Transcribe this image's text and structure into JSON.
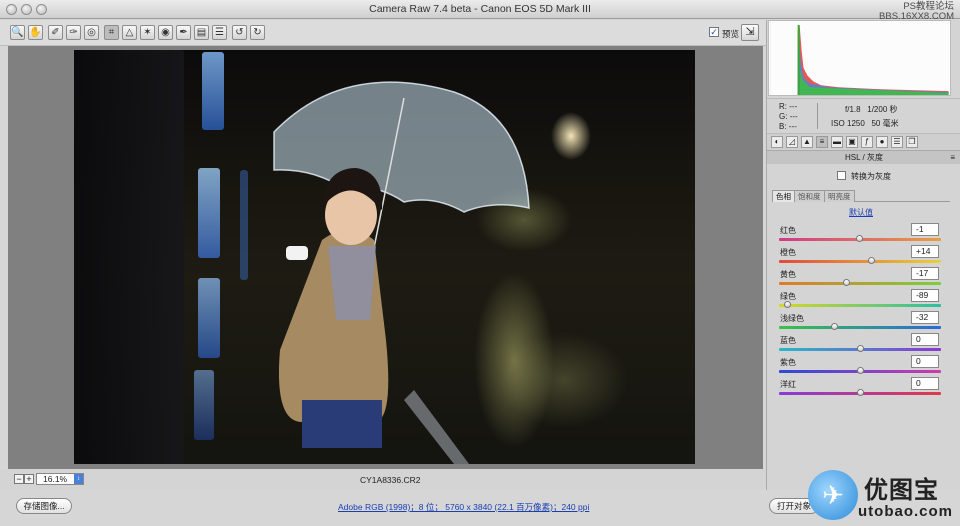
{
  "window": {
    "title": "Camera Raw 7.4 beta -  Canon EOS 5D Mark III"
  },
  "watermark_top": {
    "line1": "PS教程论坛",
    "line2": "BBS.16XX8.COM"
  },
  "toolbar": {
    "tools": [
      "zoom-tool",
      "hand-tool",
      "white-balance-tool",
      "color-sampler-tool",
      "targeted-adjustment-tool",
      "crop-tool",
      "straighten-tool",
      "spot-removal-tool",
      "red-eye-tool",
      "adjustment-brush-tool",
      "graduated-filter-tool",
      "radial-filter-tool",
      "preferences",
      "rotate-left",
      "rotate-right"
    ],
    "preview_label": "预览",
    "preview_checked": true
  },
  "status": {
    "zoom": "16.1%",
    "filename": "CY1A8336.CR2"
  },
  "bottom": {
    "save_label": "存储图像...",
    "workflow_text": "Adobe RGB (1998)；8 位；  5760 x 3840 (22.1 百万像素)；240 ppi",
    "open_label": "打开对象"
  },
  "watermark_bottom": {
    "brand": "优图宝",
    "url": "utobao.com"
  },
  "readout": {
    "r_label": "R:",
    "r_val": "---",
    "g_label": "G:",
    "g_val": "---",
    "b_label": "B:",
    "b_val": "---",
    "aperture": "f/1.8",
    "shutter": "1/200 秒",
    "iso": "ISO 1250",
    "focal": "50 毫米"
  },
  "panel": {
    "header": "HSL / 灰度",
    "grayscale_label": "转换为灰度",
    "subtabs": [
      "色相",
      "饱和度",
      "明亮度"
    ],
    "default_link": "默认值",
    "sliders": [
      {
        "label": "红色",
        "value": "-1",
        "norm": 0.495,
        "c1": "#d03a8a",
        "c2": "#e7a040"
      },
      {
        "label": "橙色",
        "value": "+14",
        "norm": 0.57,
        "c1": "#e24a3a",
        "c2": "#e6d23a"
      },
      {
        "label": "黄色",
        "value": "-17",
        "norm": 0.415,
        "c1": "#e07a2a",
        "c2": "#7ad03a"
      },
      {
        "label": "绿色",
        "value": "-89",
        "norm": 0.055,
        "c1": "#d6d62a",
        "c2": "#2ac0a0"
      },
      {
        "label": "浅绿色",
        "value": "-32",
        "norm": 0.34,
        "c1": "#3ac24a",
        "c2": "#2a6ad8"
      },
      {
        "label": "蓝色",
        "value": "0",
        "norm": 0.5,
        "c1": "#2ab8c8",
        "c2": "#8a3ad0"
      },
      {
        "label": "紫色",
        "value": "0",
        "norm": 0.5,
        "c1": "#2a4ad8",
        "c2": "#d03ab0"
      },
      {
        "label": "洋红",
        "value": "0",
        "norm": 0.5,
        "c1": "#8a3ad8",
        "c2": "#e03a4a"
      }
    ]
  },
  "colors": {
    "accent": "#1a3fb0",
    "canvas_bg": "#808080",
    "panel_bg": "#d4d4d4"
  }
}
